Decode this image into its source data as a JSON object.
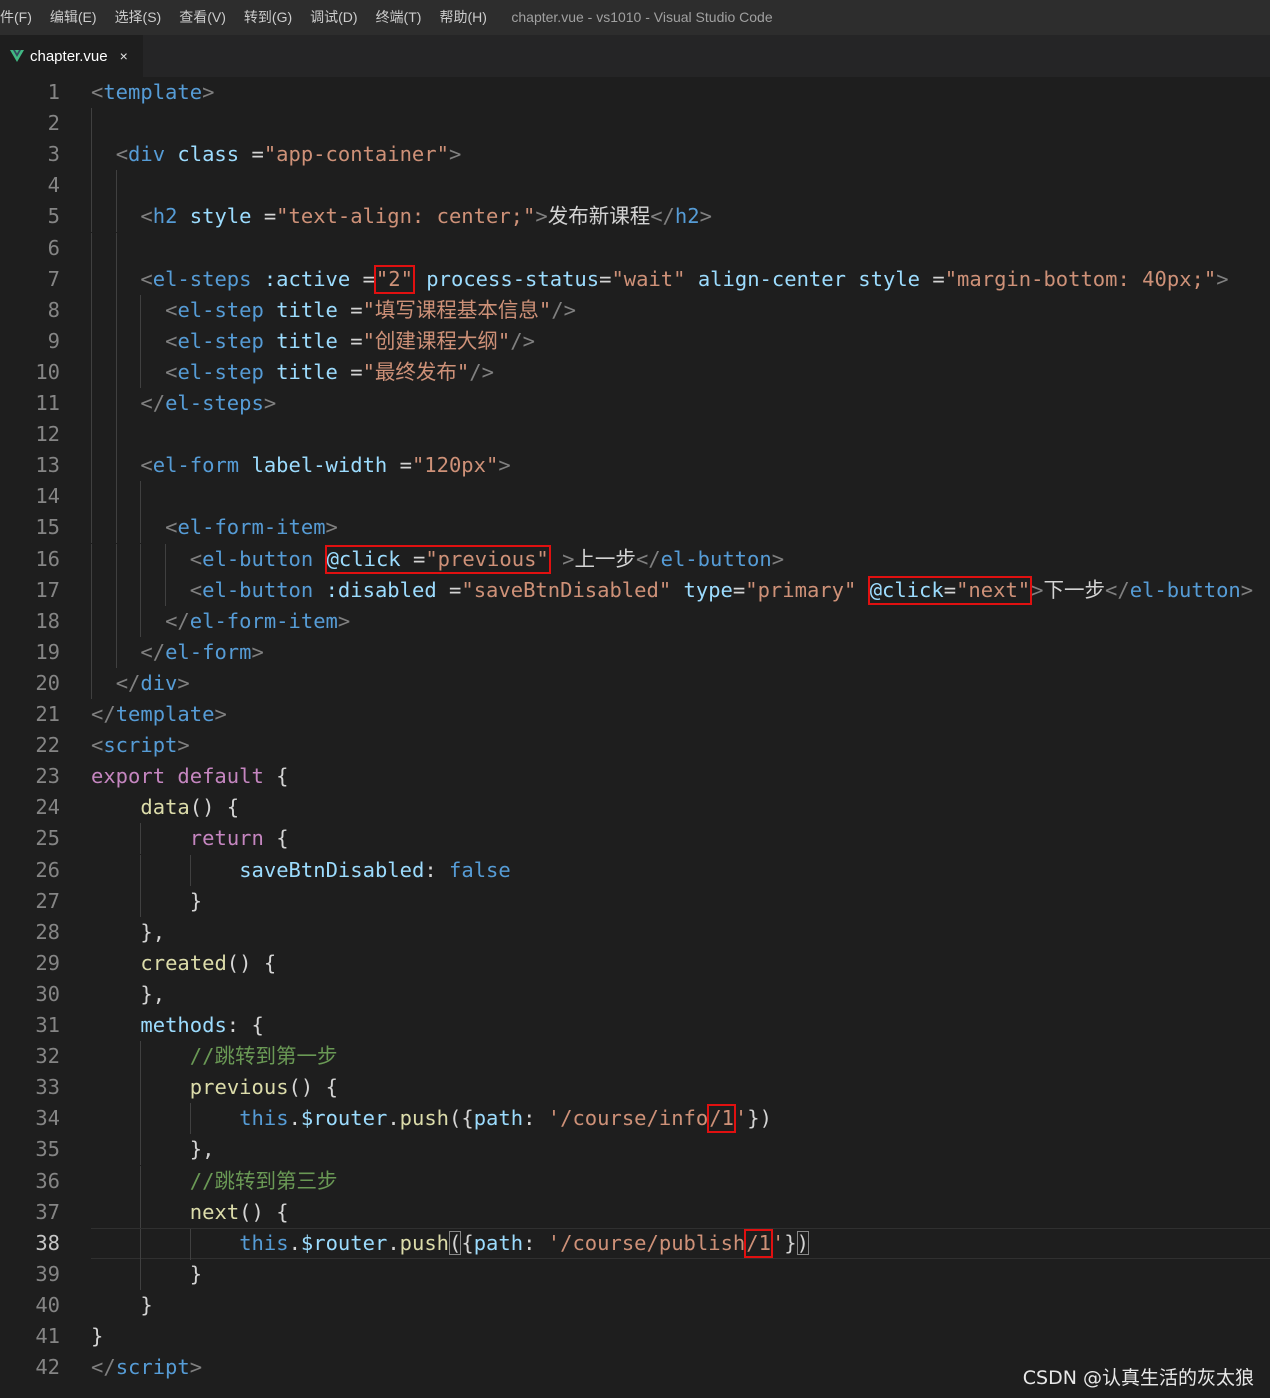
{
  "menu": [
    "件(F)",
    "编辑(E)",
    "选择(S)",
    "查看(V)",
    "转到(G)",
    "调试(D)",
    "终端(T)",
    "帮助(H)"
  ],
  "window_title": "chapter.vue - vs1010 - Visual Studio Code",
  "tab": {
    "label": "chapter.vue",
    "close": "×",
    "icon": "vue-icon"
  },
  "line_numbers": [
    "1",
    "2",
    "3",
    "4",
    "5",
    "6",
    "7",
    "8",
    "9",
    "10",
    "11",
    "12",
    "13",
    "14",
    "15",
    "16",
    "17",
    "18",
    "19",
    "20",
    "21",
    "22",
    "23",
    "24",
    "25",
    "26",
    "27",
    "28",
    "29",
    "30",
    "31",
    "32",
    "33",
    "34",
    "35",
    "36",
    "37",
    "38",
    "39",
    "40",
    "41",
    "42"
  ],
  "current_line": "38",
  "code": {
    "l1": [
      "<",
      "template",
      ">"
    ],
    "l3": [
      "<",
      "div",
      "class",
      "=",
      "\"app-container\"",
      ">"
    ],
    "l5": [
      "<",
      "h2",
      "style",
      "=",
      "\"text-align: center;\"",
      ">",
      "发布新课程",
      "</",
      "h2",
      ">"
    ],
    "l7": [
      "<",
      "el-steps",
      ":active",
      "=",
      "\"2\"",
      "process-status",
      "=",
      "\"wait\"",
      "align-center",
      "style",
      "=",
      "\"margin-bottom: 40px;\"",
      ">"
    ],
    "l8": [
      "<",
      "el-step",
      "title",
      "=",
      "\"填写课程基本信息\"",
      "/>"
    ],
    "l9": [
      "<",
      "el-step",
      "title",
      "=",
      "\"创建课程大纲\"",
      "/>"
    ],
    "l10": [
      "<",
      "el-step",
      "title",
      "=",
      "\"最终发布\"",
      "/>"
    ],
    "l11": [
      "</",
      "el-steps",
      ">"
    ],
    "l13": [
      "<",
      "el-form",
      "label-width",
      "=",
      "\"120px\"",
      ">"
    ],
    "l15": [
      "<",
      "el-form-item",
      ">"
    ],
    "l16": [
      "<",
      "el-button",
      "@click",
      "=",
      "\"previous\"",
      ">",
      "上一步",
      "</",
      "el-button",
      ">"
    ],
    "l17": [
      "<",
      "el-button",
      ":disabled",
      "=",
      "\"saveBtnDisabled\"",
      "type",
      "=",
      "\"primary\"",
      "@click",
      "=",
      "\"next\"",
      ">",
      "下一步",
      "</",
      "el-button",
      ">"
    ],
    "l18": [
      "</",
      "el-form-item",
      ">"
    ],
    "l19": [
      "</",
      "el-form",
      ">"
    ],
    "l20": [
      "</",
      "div",
      ">"
    ],
    "l21": [
      "</",
      "template",
      ">"
    ],
    "l22": [
      "<",
      "script",
      ">"
    ],
    "l23": [
      "export",
      "default",
      "{"
    ],
    "l24": [
      "data",
      "() {"
    ],
    "l25": [
      "return",
      "{"
    ],
    "l26": [
      "saveBtnDisabled",
      ":",
      "false"
    ],
    "l27": [
      "}"
    ],
    "l28": [
      "},"
    ],
    "l29": [
      "created",
      "() {"
    ],
    "l30": [
      "},"
    ],
    "l31": [
      "methods",
      ": {"
    ],
    "l32": [
      "//跳转到第一步"
    ],
    "l33": [
      "previous",
      "() {"
    ],
    "l34": [
      "this",
      ".",
      "$router",
      ".",
      "push",
      "({",
      "path",
      ":",
      "'/course/info",
      "/1",
      "'",
      "})"
    ],
    "l35": [
      "},"
    ],
    "l36": [
      "//跳转到第三步"
    ],
    "l37": [
      "next",
      "() {"
    ],
    "l38": [
      "this",
      ".",
      "$router",
      ".",
      "push",
      "(",
      "{",
      "path",
      ":",
      "'/course/publish",
      "/1",
      "'",
      "}",
      ")"
    ],
    "l39": [
      "}"
    ],
    "l40": [
      "}"
    ],
    "l41": [
      "}"
    ],
    "l42": [
      "</",
      "script",
      ">"
    ]
  },
  "watermark": "CSDN @认真生活的灰太狼",
  "colors": {
    "background": "#1e1e1e",
    "tag": "#569cd6",
    "attribute": "#9cdcfe",
    "string": "#ce9178",
    "keyword": "#c586c0",
    "function": "#dcdcaa",
    "comment": "#6a9955",
    "highlight_box": "#e01010"
  }
}
